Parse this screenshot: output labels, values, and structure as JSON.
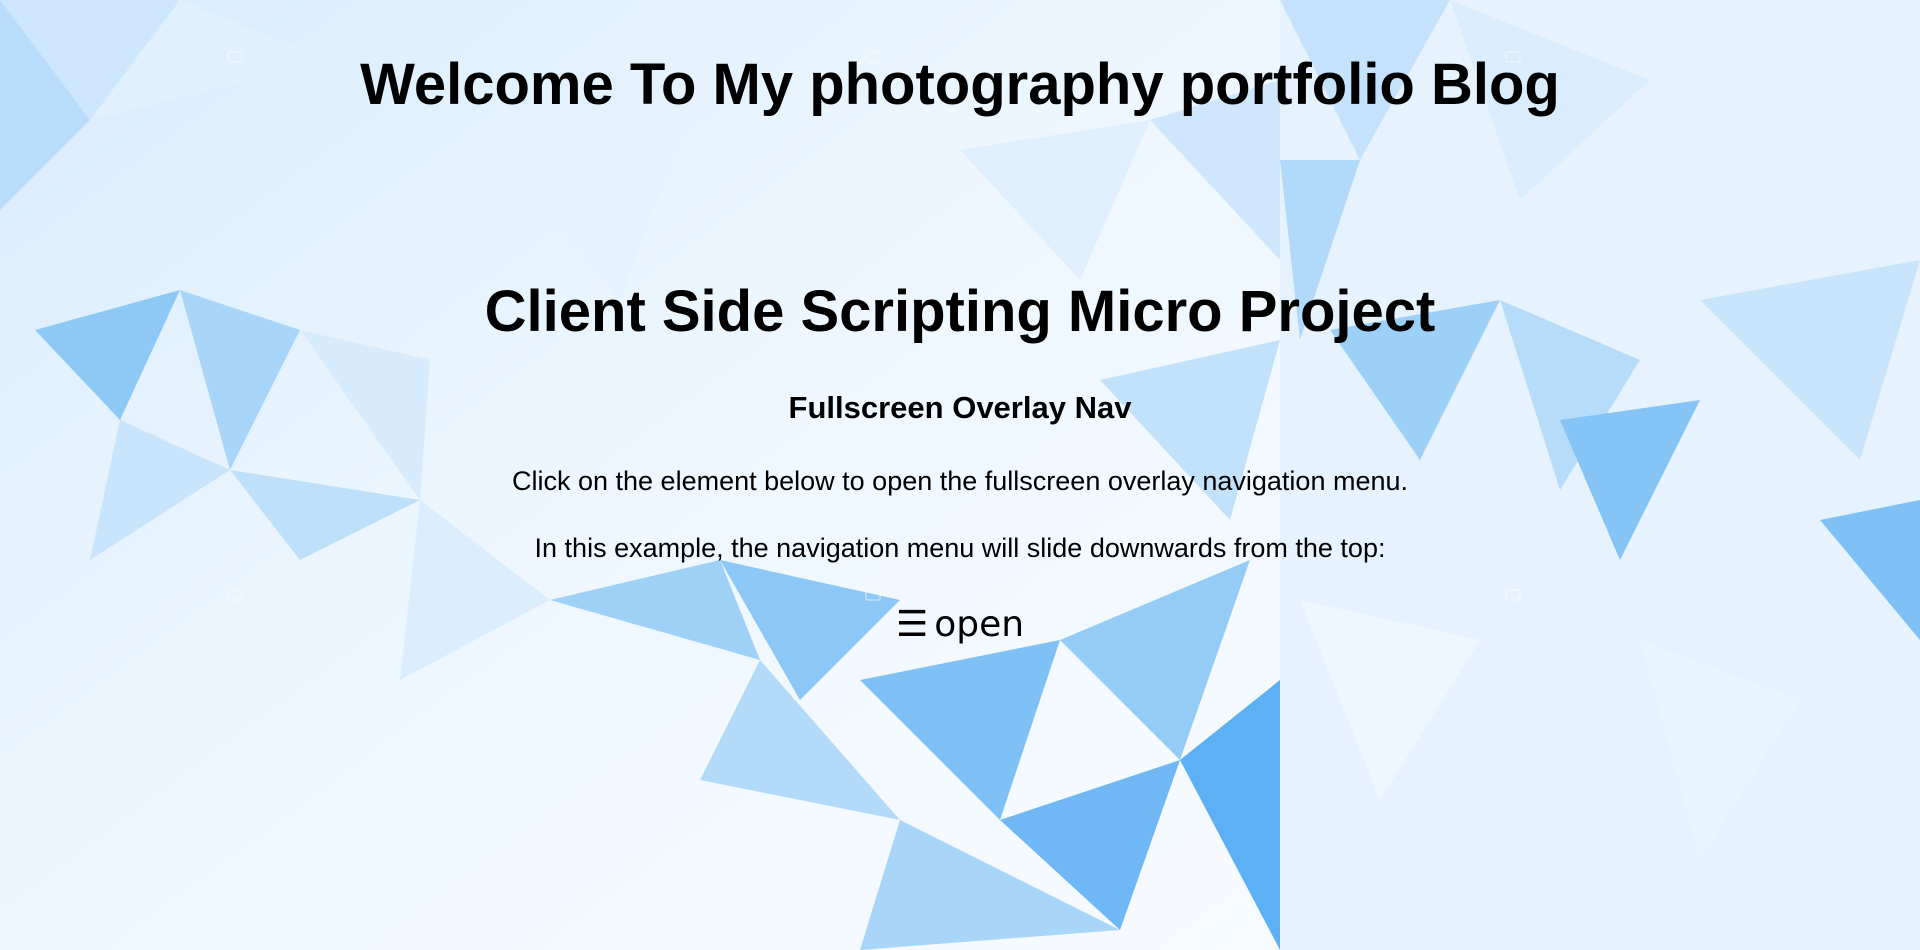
{
  "page": {
    "site_title": "Welcome To My photography portfolio Blog",
    "project_title": "Client Side Scripting Micro Project",
    "section_heading": "Fullscreen Overlay Nav",
    "paragraphs": [
      "Click on the element below to open the fullscreen overlay navigation menu.",
      "In this example, the navigation menu will slide downwards from the top:"
    ],
    "open_toggle": {
      "icon": "hamburger-icon",
      "glyph": "☰",
      "label": "open"
    }
  },
  "theme": {
    "background_light": "#eaf5fe",
    "background_mid": "#bfe0fb",
    "background_accent": "#6fb8f5",
    "text_color": "#000000"
  }
}
